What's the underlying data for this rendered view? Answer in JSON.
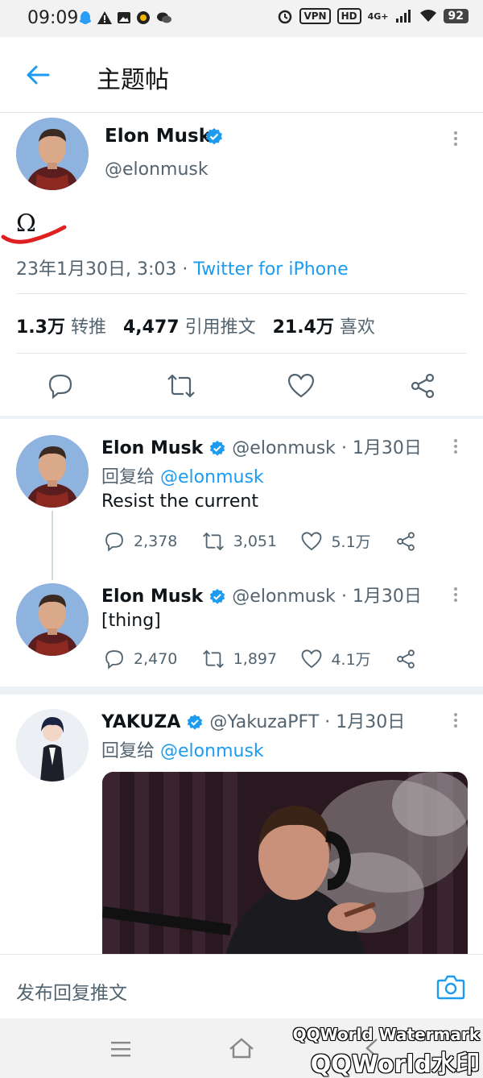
{
  "status_bar": {
    "time": "09:09",
    "vpn": "VPN",
    "hd": "HD",
    "network": "4G+",
    "battery": "92"
  },
  "header": {
    "title": "主题帖"
  },
  "main_tweet": {
    "name": "Elon Musk",
    "handle": "@elonmusk",
    "text": "Ω",
    "timestamp": "23年1月30日, 3:03",
    "separator": " · ",
    "source": "Twitter for iPhone",
    "stats": [
      {
        "value": "1.3万",
        "label": "转推"
      },
      {
        "value": "4,477",
        "label": "引用推文"
      },
      {
        "value": "21.4万",
        "label": "喜欢"
      }
    ]
  },
  "replies": [
    {
      "name": "Elon Musk",
      "handle": "@elonmusk",
      "date": "· 1月30日",
      "reply_prefix": "回复给",
      "reply_to": "@elonmusk",
      "text": "Resist the current",
      "replies": "2,378",
      "retweets": "3,051",
      "likes": "5.1万"
    },
    {
      "name": "Elon Musk",
      "handle": "@elonmusk",
      "date": "· 1月30日",
      "text": "[thing]",
      "replies": "2,470",
      "retweets": "1,897",
      "likes": "4.1万"
    },
    {
      "name": "YAKUZA",
      "handle": "@YakuzaPFT",
      "date": "· 1月30日",
      "reply_prefix": "回复给",
      "reply_to": "@elonmusk"
    }
  ],
  "composer": {
    "placeholder": "发布回复推文"
  },
  "watermark": {
    "line1": "QQWorld Watermark",
    "line2": "QQWorld水印"
  },
  "colors": {
    "accent": "#1d9bf0",
    "verified": "#1d9bf0",
    "annotation": "#e02020"
  }
}
